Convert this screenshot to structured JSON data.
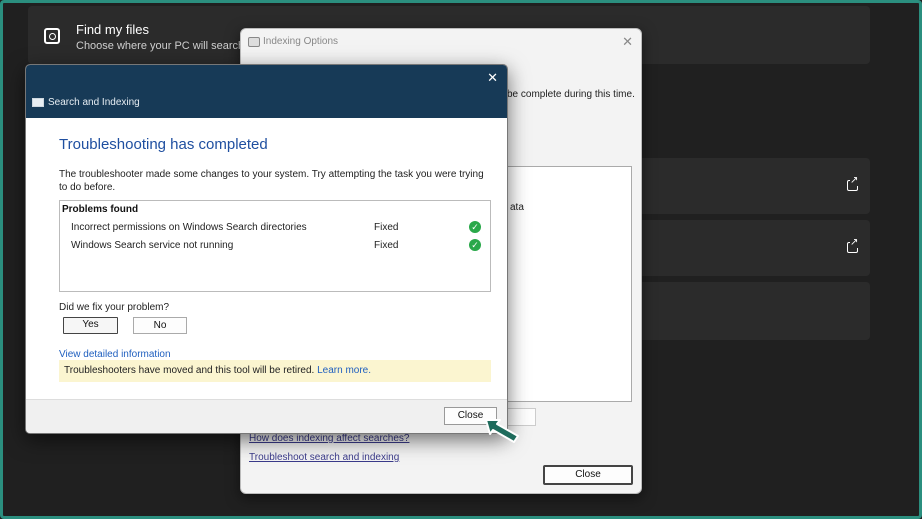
{
  "settings": {
    "find": {
      "title": "Find my files",
      "subtitle": "Choose where your PC will search f"
    }
  },
  "indexing": {
    "title": "Indexing Options",
    "partial_text": "be complete during this time.",
    "list_partial": "ata",
    "link1": "How does indexing affect searches?",
    "link2": "Troubleshoot search and indexing",
    "close_label": "Close"
  },
  "troubleshooter": {
    "window_title": "Search and Indexing",
    "heading": "Troubleshooting has completed",
    "description": "The troubleshooter made some changes to your system. Try attempting the task you were trying to do before.",
    "problems_header": "Problems found",
    "problems": [
      {
        "name": "Incorrect permissions on Windows Search directories",
        "status": "Fixed"
      },
      {
        "name": "Windows Search service not running",
        "status": "Fixed"
      }
    ],
    "question": "Did we fix your problem?",
    "yes_label": "Yes",
    "no_label": "No",
    "detail_link": "View detailed information",
    "notice_text": "Troubleshooters have moved and this tool will be retired.",
    "notice_link": "Learn more.",
    "close_label": "Close"
  },
  "colors": {
    "frame": "#2b8f7f",
    "dialog_header": "#173a57",
    "heading": "#1f4fa0",
    "notice_bg": "#fbf5d0",
    "check": "#2aa84a"
  },
  "icons": [
    "search-icon",
    "external-link-icon",
    "close-icon",
    "check-icon",
    "cursor-arrow-icon"
  ]
}
